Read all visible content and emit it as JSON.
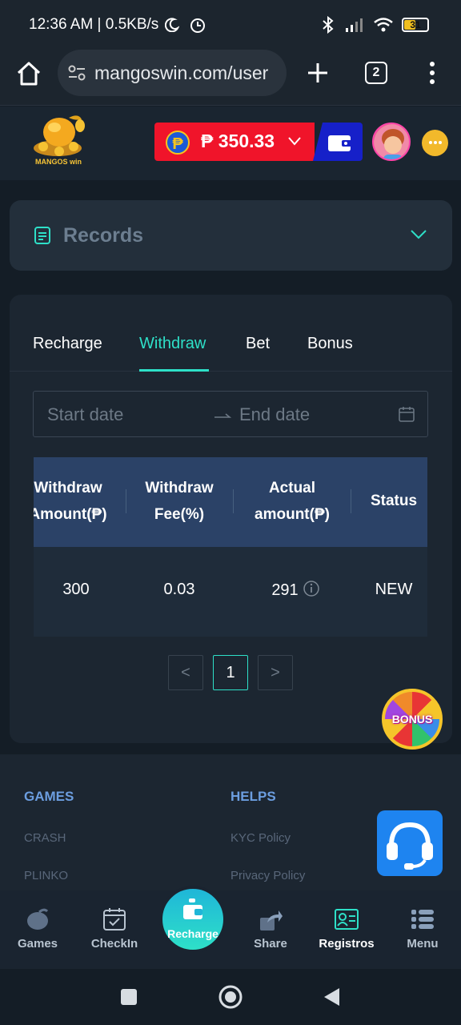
{
  "status_bar": {
    "time": "12:36 AM | 0.5KB/s",
    "battery": "31"
  },
  "browser": {
    "url": "mangoswin.com/user",
    "tab_count": "2"
  },
  "header": {
    "logo_text": "MANGOS win",
    "currency_symbol": "₱",
    "balance": "₱ 350.33"
  },
  "records": {
    "title": "Records"
  },
  "tabs": [
    {
      "label": "Recharge",
      "active": false
    },
    {
      "label": "Withdraw",
      "active": true
    },
    {
      "label": "Bet",
      "active": false
    },
    {
      "label": "Bonus",
      "active": false
    }
  ],
  "date_range": {
    "start_placeholder": "Start date",
    "end_placeholder": "End date"
  },
  "table": {
    "headers": [
      [
        "Withdraw",
        "Amount(₱)"
      ],
      [
        "Withdraw",
        "Fee(%)"
      ],
      [
        "Actual",
        "amount(₱)"
      ],
      [
        "Status"
      ]
    ],
    "rows": [
      {
        "amount": "300",
        "fee": "0.03",
        "actual": "291",
        "status": "NEW"
      }
    ]
  },
  "pagination": {
    "prev": "<",
    "current": "1",
    "next": ">"
  },
  "bonus_badge": "BONUS",
  "footer": {
    "games_heading": "GAMES",
    "games_links": [
      "CRASH",
      "PLINKO"
    ],
    "helps_heading": "HELPS",
    "helps_links": [
      "KYC Policy",
      "Privacy Policy"
    ]
  },
  "bottom_nav": [
    {
      "label": "Games",
      "icon": "mango-icon"
    },
    {
      "label": "CheckIn",
      "icon": "calendar-check-icon"
    },
    {
      "label": "Recharge",
      "icon": "wallet-icon"
    },
    {
      "label": "Share",
      "icon": "share-icon"
    },
    {
      "label": "Registros",
      "icon": "id-card-icon",
      "active": true
    },
    {
      "label": "Menu",
      "icon": "menu-list-icon"
    }
  ],
  "colors": {
    "accent": "#2ee0c8",
    "balance_red": "#f0142a",
    "wallet_blue": "#1620c9",
    "table_header": "#2b4267"
  }
}
